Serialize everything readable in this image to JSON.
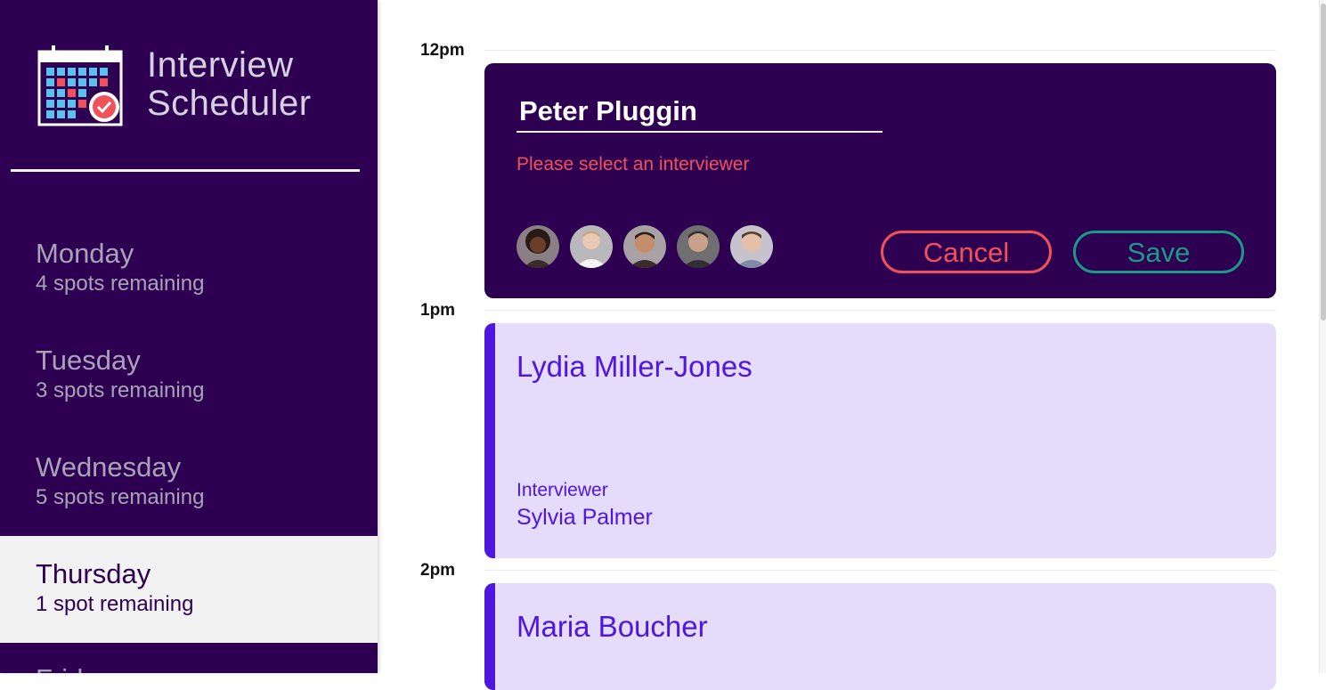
{
  "app": {
    "title_line1": "Interview",
    "title_line2": "Scheduler"
  },
  "sidebar": {
    "days": [
      {
        "name": "Monday",
        "spots": "4 spots remaining",
        "selected": false
      },
      {
        "name": "Tuesday",
        "spots": "3 spots remaining",
        "selected": false
      },
      {
        "name": "Wednesday",
        "spots": "5 spots remaining",
        "selected": false
      },
      {
        "name": "Thursday",
        "spots": "1 spot remaining",
        "selected": true
      },
      {
        "name": "Friday",
        "spots": "",
        "selected": false
      }
    ]
  },
  "schedule": {
    "times": [
      "12pm",
      "1pm",
      "2pm"
    ],
    "form": {
      "student_name": "Peter Pluggin",
      "error": "Please select an interviewer",
      "cancel_label": "Cancel",
      "save_label": "Save",
      "interviewers": [
        "avatar-1",
        "avatar-2",
        "avatar-3",
        "avatar-4",
        "avatar-5"
      ]
    },
    "appointments": [
      {
        "student": "Lydia Miller-Jones",
        "interviewer_label": "Interviewer",
        "interviewer": "Sylvia Palmer"
      },
      {
        "student": "Maria Boucher"
      }
    ]
  },
  "colors": {
    "sidebar_bg": "#2e0052",
    "selected_day_bg": "#f2f2f2",
    "appointment_bg": "#e5dcfb",
    "appointment_accent": "#4f16e0",
    "danger": "#f0525b",
    "success": "#1b9a87"
  }
}
